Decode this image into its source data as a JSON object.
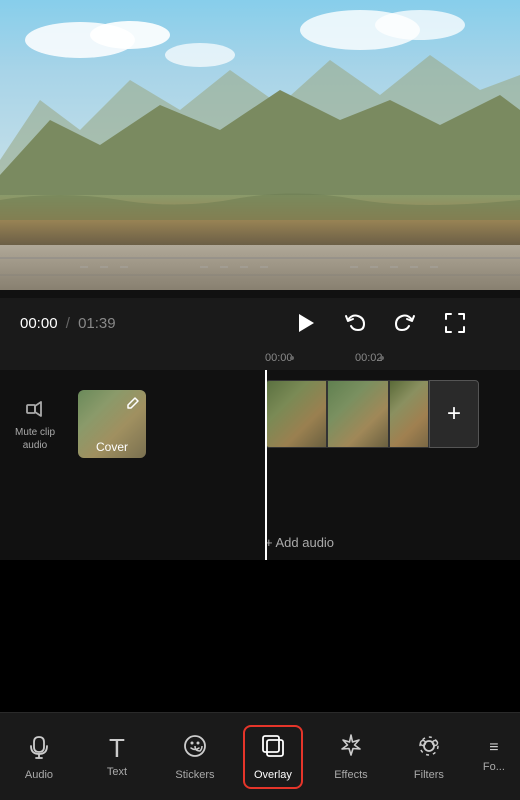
{
  "preview": {
    "alt": "Landscape video preview"
  },
  "controls": {
    "time_current": "00:00",
    "time_separator": "/",
    "time_total": "01:39"
  },
  "timeline": {
    "marker_start": "00:00",
    "marker_mid": "00:02",
    "add_audio_label": "+ Add audio"
  },
  "clip_controls": {
    "mute_label": "Mute clip\naudio",
    "cover_label": "Cover"
  },
  "toolbar": {
    "items": [
      {
        "id": "audio",
        "label": "Audio",
        "icon": "♪",
        "active": false
      },
      {
        "id": "text",
        "label": "Text",
        "icon": "T",
        "active": false
      },
      {
        "id": "stickers",
        "label": "Stickers",
        "icon": "◎",
        "active": false
      },
      {
        "id": "overlay",
        "label": "Overlay",
        "icon": "⊞",
        "active": true
      },
      {
        "id": "effects",
        "label": "Effects",
        "icon": "✦",
        "active": false
      },
      {
        "id": "filters",
        "label": "Filters",
        "icon": "❀",
        "active": false
      },
      {
        "id": "more",
        "label": "Fo...",
        "icon": "≡",
        "active": false
      }
    ]
  }
}
